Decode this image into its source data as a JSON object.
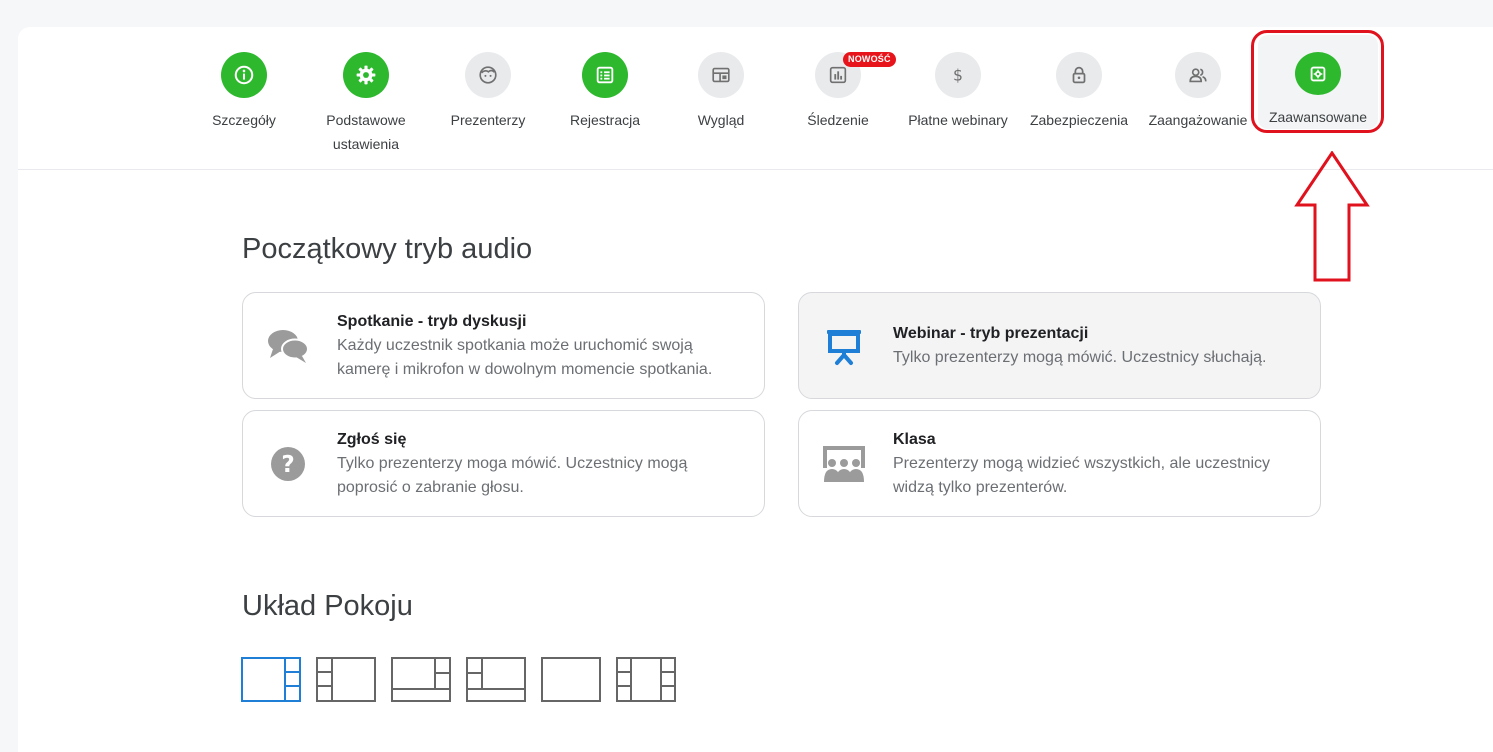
{
  "nav": {
    "items": [
      {
        "label": "Szczegóły",
        "icon": "info-icon"
      },
      {
        "label": "Podstawowe\nustawienia",
        "icon": "gear-icon"
      },
      {
        "label": "Prezenterzy",
        "icon": "face-icon"
      },
      {
        "label": "Rejestracja",
        "icon": "form-icon"
      },
      {
        "label": "Wygląd",
        "icon": "layout-icon"
      },
      {
        "label": "Śledzenie",
        "icon": "chart-icon",
        "badge": "NOWOŚĆ"
      },
      {
        "label": "Płatne webinary",
        "icon": "dollar-icon"
      },
      {
        "label": "Zabezpieczenia",
        "icon": "lock-icon"
      },
      {
        "label": "Zaangażowanie",
        "icon": "users-icon"
      },
      {
        "label": "Zaawansowane",
        "icon": "advanced-settings-icon"
      }
    ]
  },
  "audio": {
    "title": "Początkowy tryb audio",
    "options": [
      {
        "title": "Spotkanie - tryb dyskusji",
        "desc": "Każdy uczestnik spotkania może uruchomić swoją kamerę i mikrofon w dowolnym momencie spotkania.",
        "icon": "chat-bubbles-icon"
      },
      {
        "title": "Webinar - tryb prezentacji",
        "desc": "Tylko prezenterzy mogą mówić. Uczestnicy słuchają.",
        "icon": "presentation-icon"
      },
      {
        "title": "Zgłoś się",
        "desc": "Tylko prezenterzy moga mówić. Uczestnicy mogą poprosić o zabranie głosu.",
        "icon": "question-icon"
      },
      {
        "title": "Klasa",
        "desc": "Prezenterzy mogą widzieć wszystkich, ale uczestnicy widzą tylko prezenterów.",
        "icon": "classroom-icon"
      }
    ]
  },
  "room_layout": {
    "title": "Układ Pokoju"
  },
  "colors": {
    "green": "#2eb82e",
    "blue": "#1f7fd6",
    "red": "#e0121e",
    "badge_red": "#e8141b"
  }
}
